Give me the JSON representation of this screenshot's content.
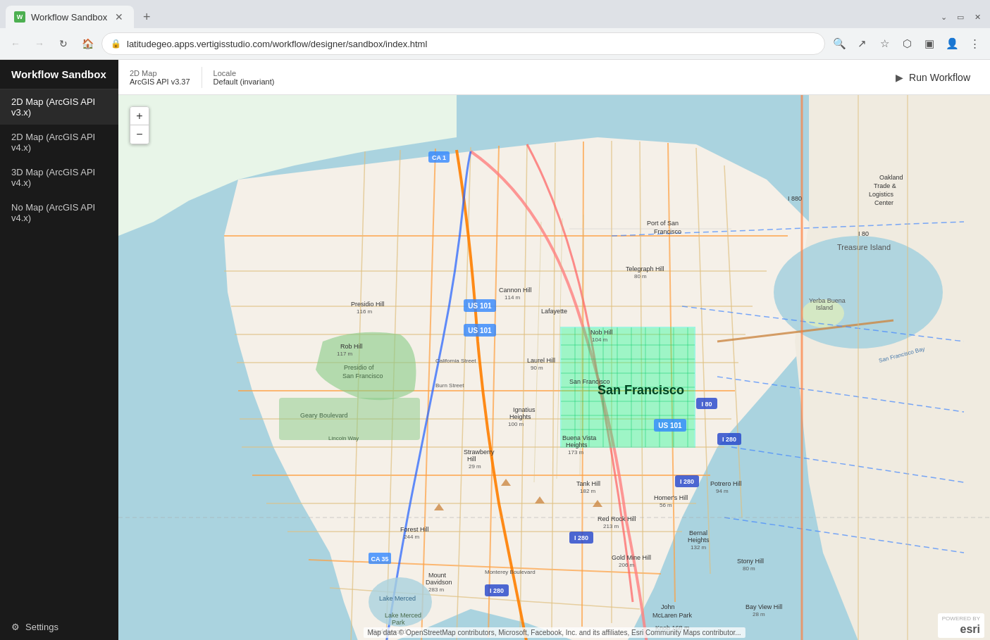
{
  "browser": {
    "tab_title": "Workflow Sandbox",
    "tab_favicon": "W",
    "url": "latitudegeo.apps.vertigisstudio.com/workflow/designer/sandbox/index.html"
  },
  "sidebar": {
    "title": "Workflow Sandbox",
    "items": [
      {
        "id": "2d-v3",
        "label": "2D Map (ArcGIS API v3.x)",
        "active": true
      },
      {
        "id": "2d-v4",
        "label": "2D Map (ArcGIS API v4.x)",
        "active": false
      },
      {
        "id": "3d-v4",
        "label": "3D Map (ArcGIS API v4.x)",
        "active": false
      },
      {
        "id": "no-map",
        "label": "No Map (ArcGIS API v4.x)",
        "active": false
      }
    ],
    "settings_label": "Settings"
  },
  "toolbar": {
    "map_label": "2D Map",
    "api_label": "ArcGIS API v3.37",
    "locale_label": "Locale",
    "locale_value": "Default (invariant)",
    "run_button": "Run Workflow"
  },
  "map": {
    "zoom_in": "+",
    "zoom_out": "−",
    "attribution": "Map data © OpenStreetMap contributors, Microsoft, Facebook, Inc. and its affiliates, Esri Community Maps contributor...",
    "powered_by": "POWERED BY",
    "esri_brand": "esri",
    "san_francisco_label": "San Francisco"
  }
}
